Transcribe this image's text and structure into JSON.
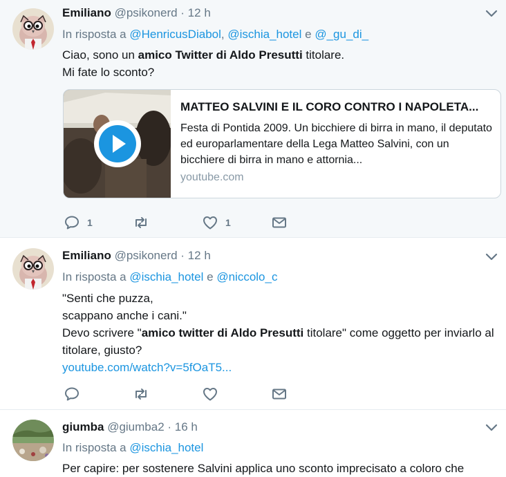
{
  "tweets": [
    {
      "name": "Emiliano",
      "handle": "@psikonerd",
      "time": "· 12 h",
      "reply_prefix": "In risposta a",
      "mentions": [
        "@HenricusDiabol",
        "@ischia_hotel",
        "@_gu_di_"
      ],
      "sep1": ",",
      "sep2": "e",
      "text_line1_a": "Ciao, sono un ",
      "text_line1_bold": "amico Twitter di Aldo Presutti",
      "text_line1_b": " titolare.",
      "text_line2": "Mi fate lo sconto?",
      "card": {
        "title": "MATTEO SALVINI E IL CORO CONTRO I NAPOLETA...",
        "description": "Festa di Pontida 2009. Un bicchiere di birra in mano, il deputato ed europarlamentare della Lega Matteo Salvini, con un bicchiere di birra in mano e attornia...",
        "domain": "youtube.com"
      },
      "reply_count": "1",
      "like_count": "1"
    },
    {
      "name": "Emiliano",
      "handle": "@psikonerd",
      "time": "· 12 h",
      "reply_prefix": "In risposta a",
      "mentions": [
        "@ischia_hotel",
        "@niccolo_c"
      ],
      "sep": "e",
      "line1": "\"Senti che puzza,",
      "line2": "scappano anche i cani.\"",
      "line3_a": "Devo scrivere \"",
      "line3_bold": "amico twitter di Aldo Presutti",
      "line3_b": " titolare\" come oggetto per inviarlo al titolare, giusto?",
      "link": "youtube.com/watch?v=5fOaT5..."
    },
    {
      "name": "giumba",
      "handle": "@giumba2",
      "time": "· 16 h",
      "reply_prefix": "In risposta a",
      "mentions": [
        "@ischia_hotel"
      ],
      "text": "Per capire: per sostenere Salvini applica uno sconto imprecisato a coloro che"
    }
  ],
  "colors": {
    "link": "#1b95e0",
    "muted": "#657786",
    "highlight_bg": "#f5f8fa"
  },
  "icons": [
    "chevron-down-icon",
    "reply-icon",
    "retweet-icon",
    "heart-icon",
    "envelope-icon",
    "play-icon"
  ]
}
